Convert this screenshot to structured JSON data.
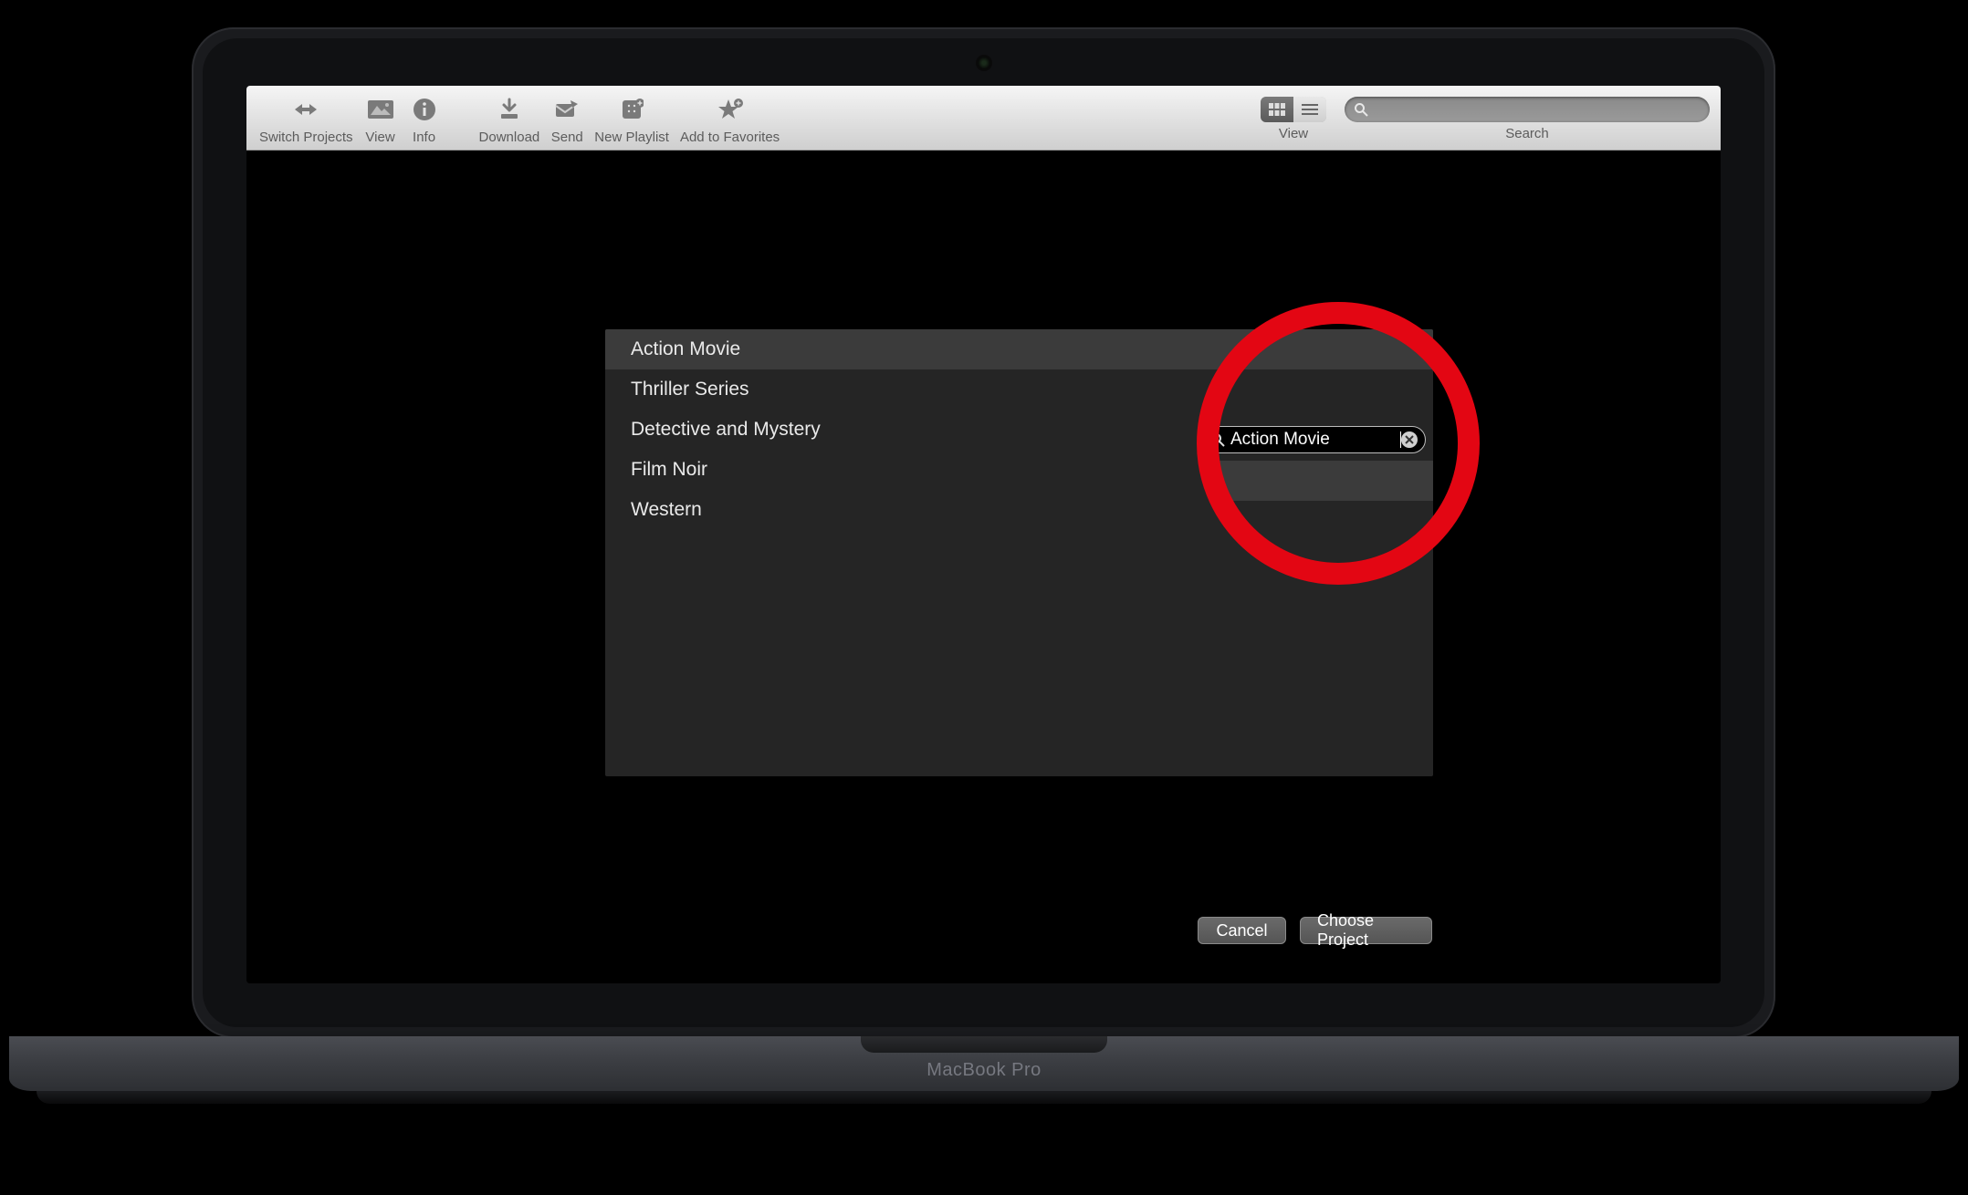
{
  "device_label": "MacBook Pro",
  "toolbar": {
    "items": [
      {
        "label": "Switch Projects"
      },
      {
        "label": "View"
      },
      {
        "label": "Info"
      },
      {
        "label": "Download"
      },
      {
        "label": "Send"
      },
      {
        "label": "New Playlist"
      },
      {
        "label": "Add to Favorites"
      }
    ],
    "view_section_label": "View",
    "search_section_label": "Search"
  },
  "dialog": {
    "search_value": "Action Movie",
    "items": [
      "Action Movie",
      "Thriller Series",
      "Detective and Mystery",
      "Film Noir",
      "Western"
    ],
    "cancel_label": "Cancel",
    "choose_label": "Choose Project"
  }
}
